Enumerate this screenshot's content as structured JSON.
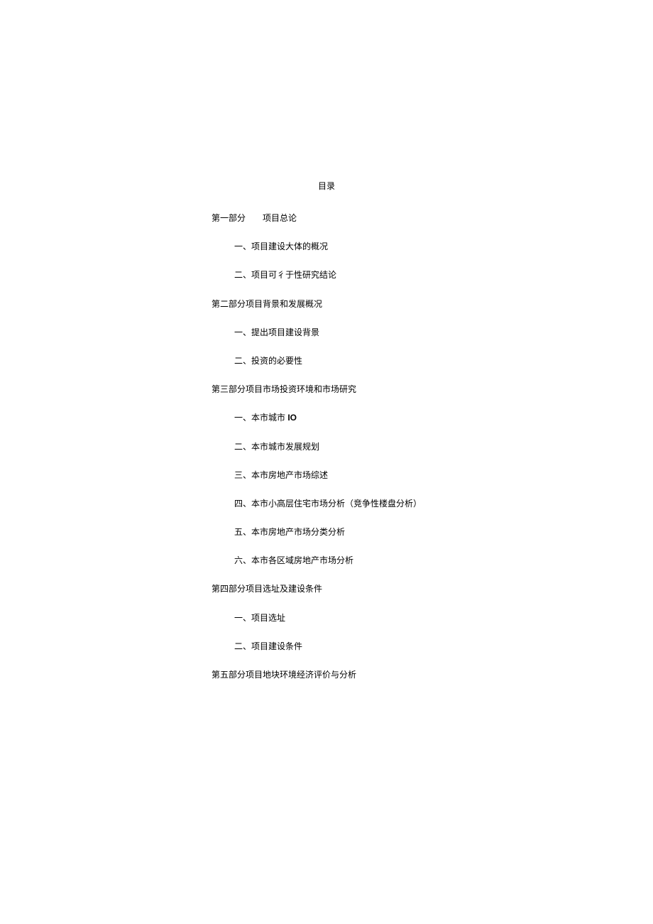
{
  "title": "目录",
  "sections": [
    {
      "heading": "第一部分　　项目总论",
      "items": [
        "一、项目建设大体的概况",
        "二、项目可彳于性研究结论"
      ]
    },
    {
      "heading": "第二部分项目背景和发展概况",
      "items": [
        "一、提出项目建设背景",
        "二、投资的必要性"
      ]
    },
    {
      "heading": "第三部分项目市场投资环境和市场研究",
      "items": [
        "一、本市城市 IO",
        "二、本市城市发展规划",
        "三、本市房地产市场综述",
        "四、本市小高层住宅市场分析（竞争性楼盘分析）",
        "五、本市房地产市场分类分析",
        "六、本市各区域房地产市场分析"
      ]
    },
    {
      "heading": "第四部分项目选址及建设条件",
      "items": [
        "一、项目选址",
        "二、项目建设条件"
      ]
    },
    {
      "heading": "第五部分项目地块环境经济评价与分析",
      "items": []
    }
  ]
}
